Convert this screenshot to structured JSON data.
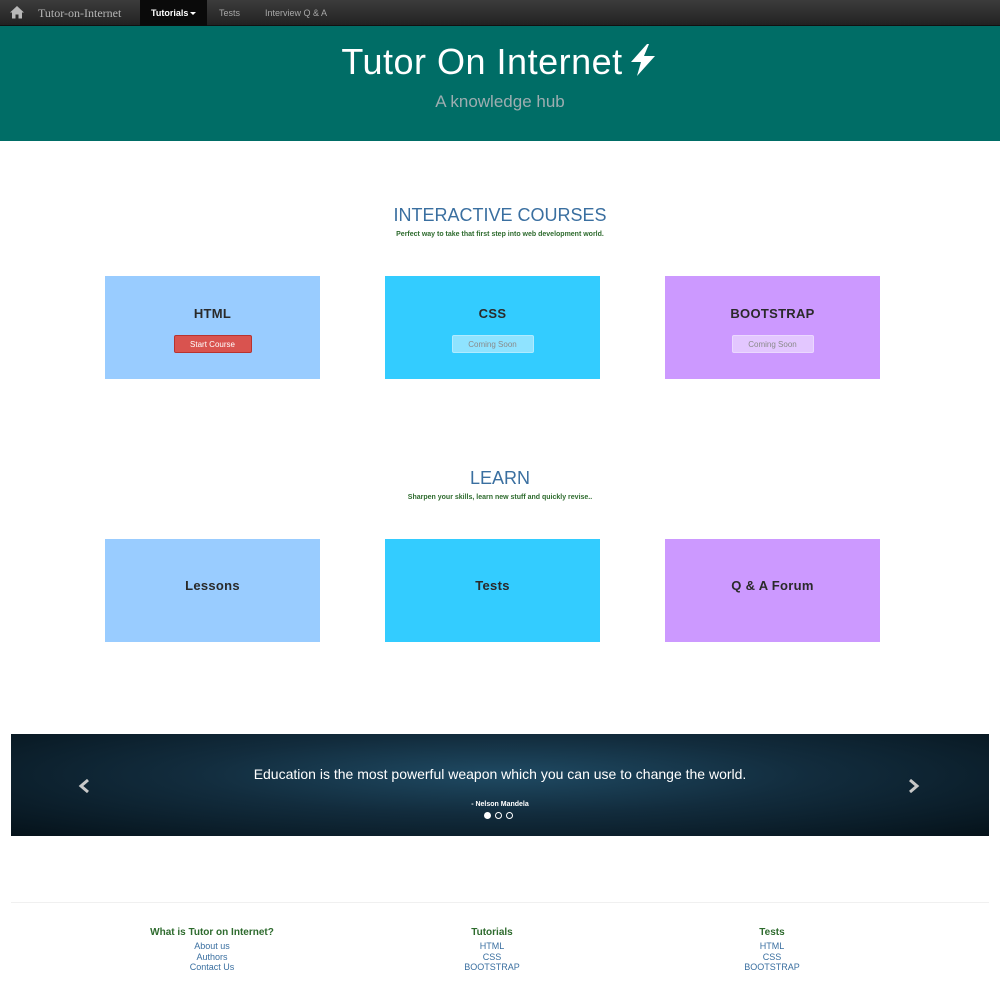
{
  "navbar": {
    "brand": "Tutor-on-Internet",
    "items": [
      {
        "label": "Tutorials"
      },
      {
        "label": "Tests"
      },
      {
        "label": "Interview Q & A"
      }
    ]
  },
  "hero": {
    "title": "Tutor On Internet",
    "subtitle": "A knowledge hub"
  },
  "courses": {
    "title": "INTERACTIVE COURSES",
    "subtitle": "Perfect way to take that first step into web development world.",
    "cards": [
      {
        "title": "HTML",
        "button": "Start Course",
        "color": "#99ccff"
      },
      {
        "title": "CSS",
        "button": "Coming Soon",
        "color": "#33ccff"
      },
      {
        "title": "BOOTSTRAP",
        "button": "Coming Soon",
        "color": "#cc99ff"
      }
    ]
  },
  "learn": {
    "title": "LEARN",
    "subtitle": "Sharpen your skills, learn new stuff and quickly revise..",
    "cards": [
      {
        "title": "Lessons",
        "color": "#99ccff"
      },
      {
        "title": "Tests",
        "color": "#33ccff"
      },
      {
        "title": "Q & A Forum",
        "color": "#cc99ff"
      }
    ]
  },
  "carousel": {
    "quote": "Education is the most powerful weapon which you can use to change the world.",
    "author": "- Nelson Mandela",
    "slide_count": 3,
    "active_slide": 1
  },
  "footer": {
    "columns": [
      {
        "heading": "What is Tutor on Internet?",
        "links": [
          "About us",
          "Authors",
          "Contact Us"
        ]
      },
      {
        "heading": "Tutorials",
        "links": [
          "HTML",
          "CSS",
          "BOOTSTRAP"
        ]
      },
      {
        "heading": "Tests",
        "links": [
          "HTML",
          "CSS",
          "BOOTSTRAP"
        ]
      }
    ]
  },
  "colors": {
    "hero_bg": "#006d66",
    "accent_blue": "#3a6fa0",
    "accent_green": "#2e6b2e",
    "start_button": "#d9534f"
  }
}
